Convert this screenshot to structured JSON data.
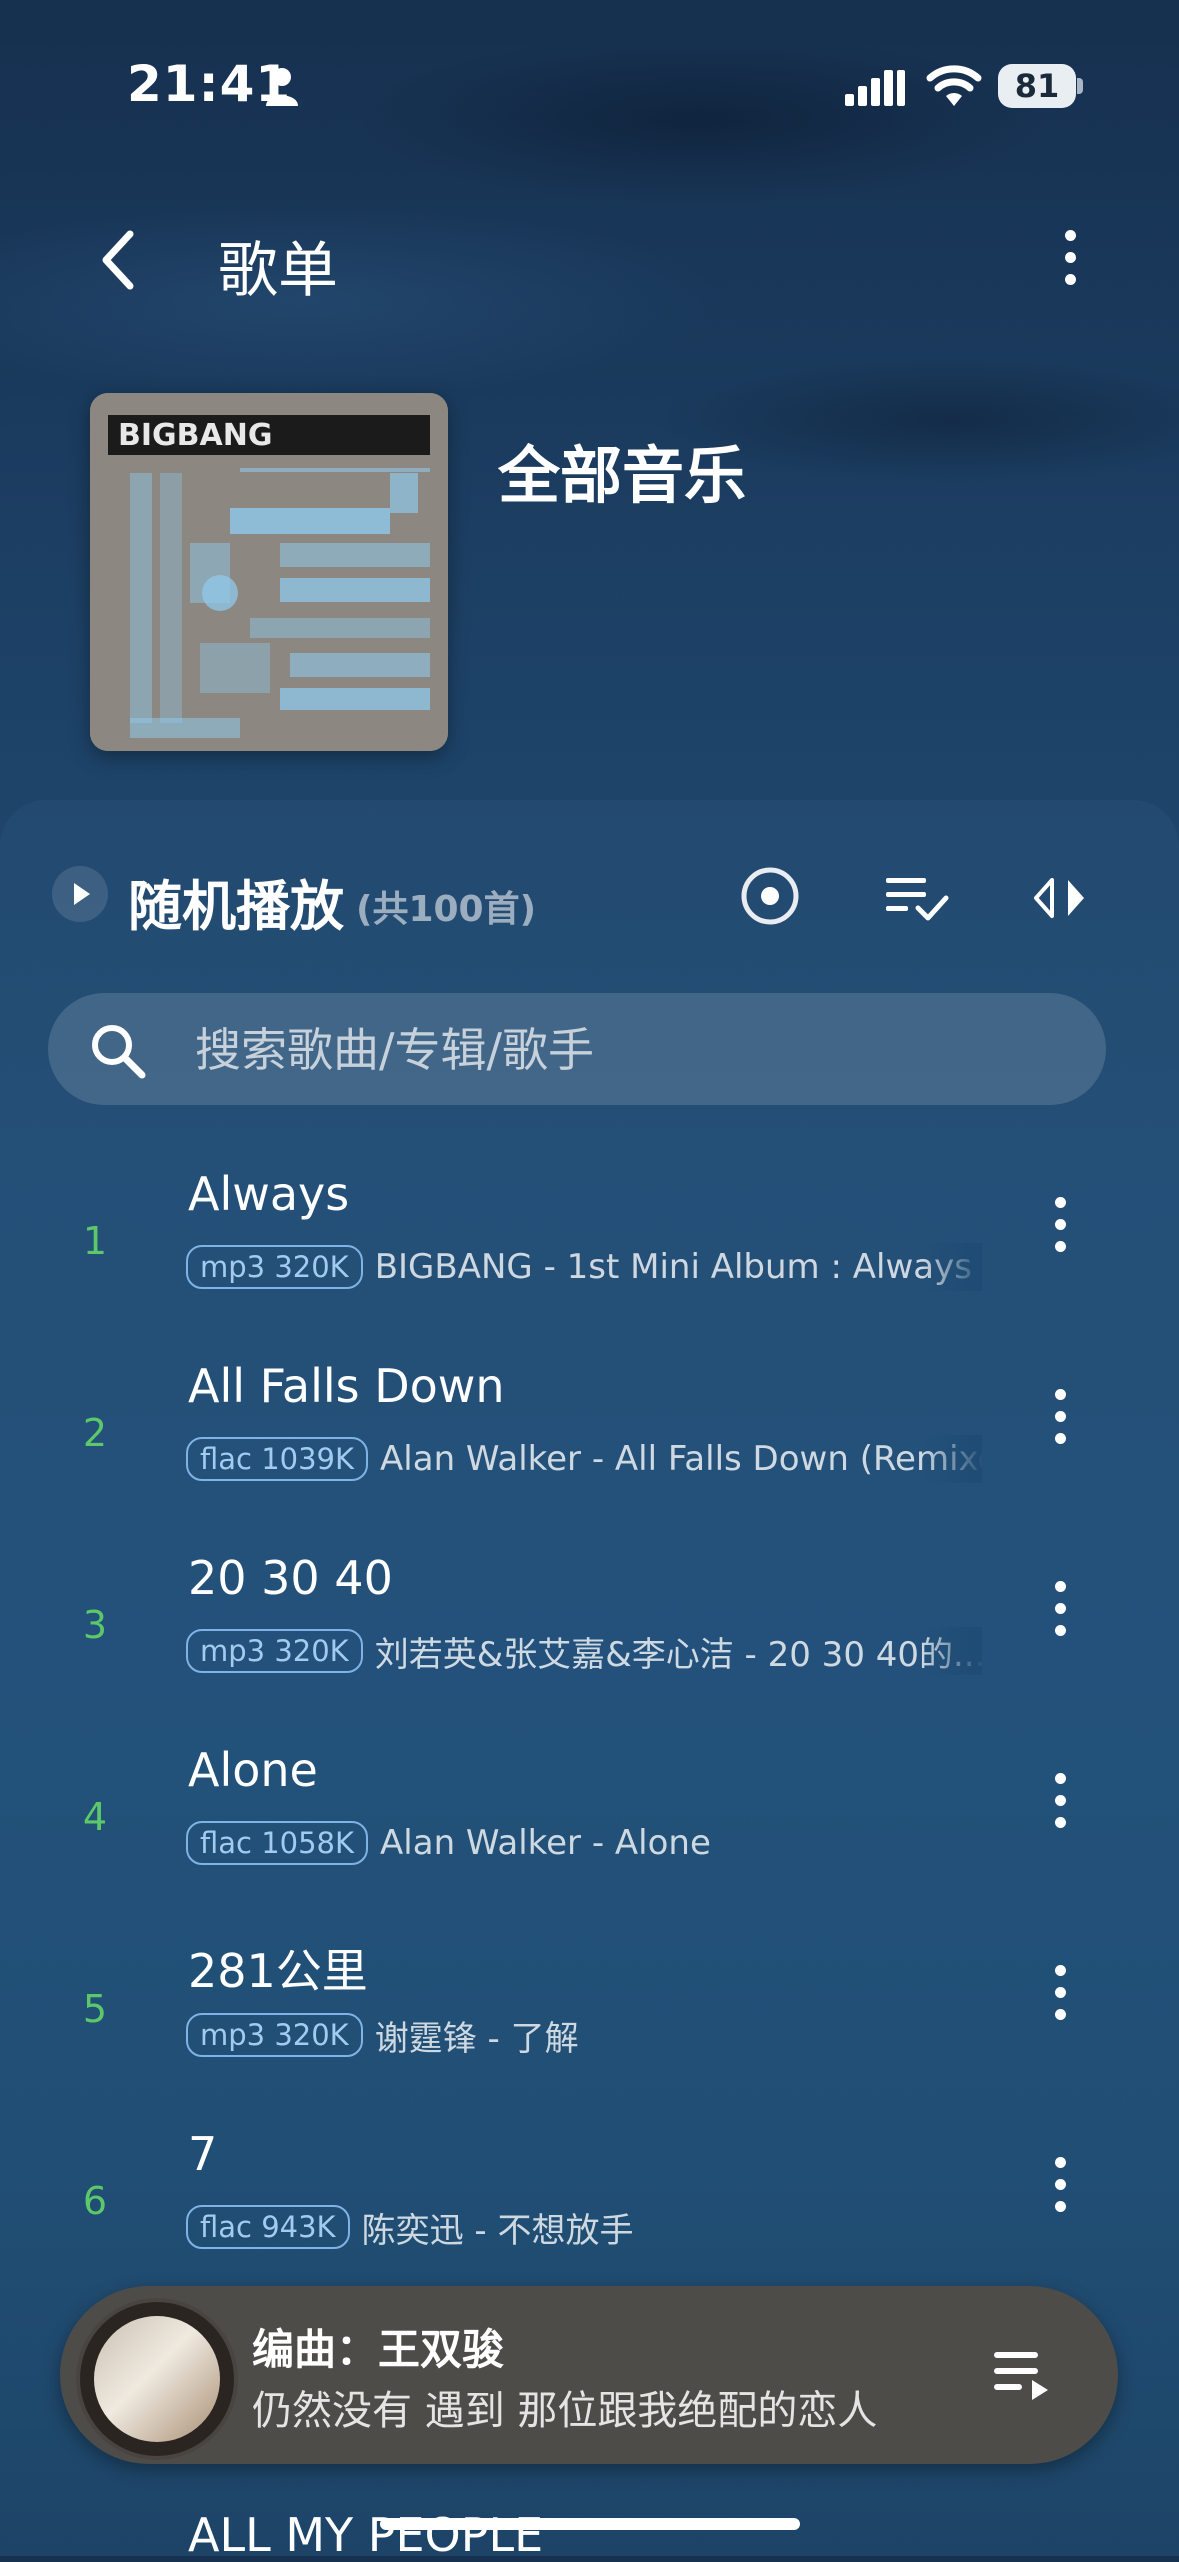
{
  "status_bar": {
    "time": "21:41",
    "battery": "81"
  },
  "header": {
    "title": "歌单"
  },
  "playlist": {
    "title": "全部音乐",
    "cover_text": "BIGBANG"
  },
  "controls": {
    "shuffle_label": "随机播放",
    "count": "(共100首)"
  },
  "search": {
    "placeholder": "搜索歌曲/专辑/歌手"
  },
  "songs": [
    {
      "index": "1",
      "title": "Always",
      "quality": "mp3 320K",
      "artist_album": "BIGBANG - 1st Mini Album : Always"
    },
    {
      "index": "2",
      "title": "All Falls Down",
      "quality": "flac 1039K",
      "artist_album": "Alan Walker - All Falls Down (Remixes)"
    },
    {
      "index": "3",
      "title": "20 30 40",
      "quality": "mp3 320K",
      "artist_album": "刘若英&张艾嘉&李心洁 - 20 30 40的..."
    },
    {
      "index": "4",
      "title": "Alone",
      "quality": "flac 1058K",
      "artist_album": "Alan Walker - Alone"
    },
    {
      "index": "5",
      "title": "281公里",
      "quality": "mp3 320K",
      "artist_album": "谢霆锋 - 了解"
    },
    {
      "index": "6",
      "title": "7",
      "quality": "flac 943K",
      "artist_album": "陈奕迅 - 不想放手"
    }
  ],
  "next_song_peek": "ALL MY PEOPLE",
  "now_playing": {
    "title": "编曲：王双骏",
    "lyric": "仍然没有 遇到 那位跟我绝配的恋人"
  },
  "colors": {
    "index_green": "#5cc86a",
    "badge_blue": "#7fb3e6"
  }
}
